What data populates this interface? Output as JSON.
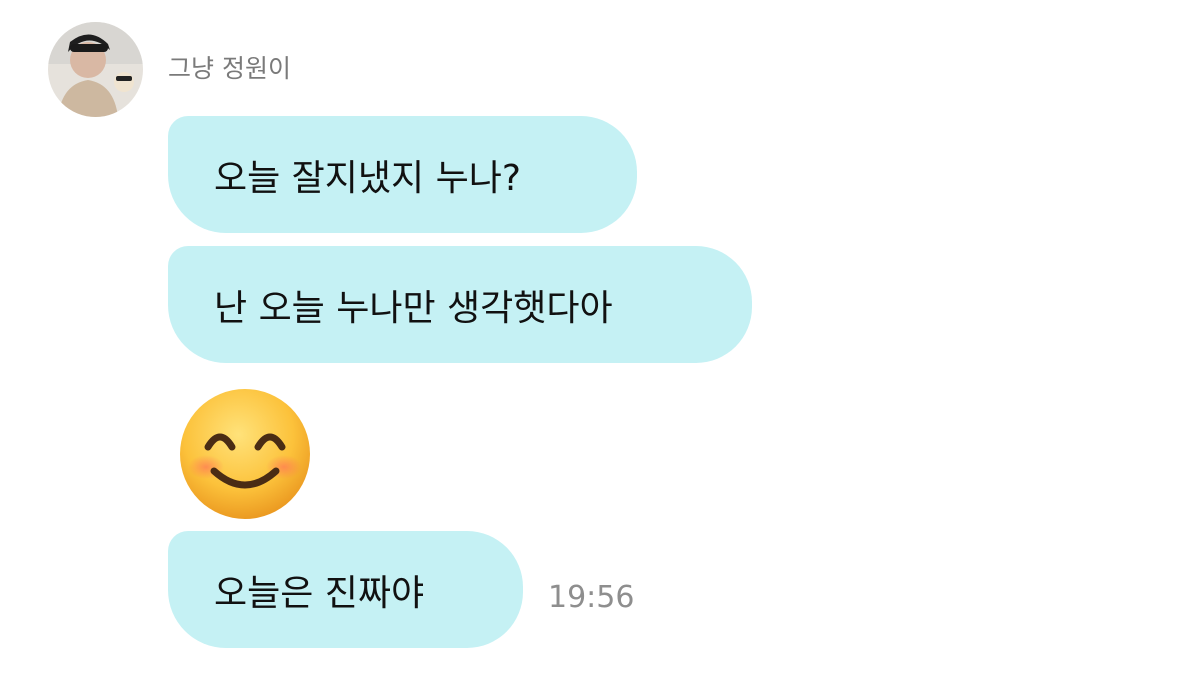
{
  "sender": {
    "name": "그냥 정원이",
    "avatar_icon": "profile-photo-avatar-icon"
  },
  "messages": [
    {
      "text": "오늘 잘지냈지 누나?"
    },
    {
      "text": "난 오늘 누나만 생각햇다아"
    },
    {
      "emoji": "smiling-face-with-smiling-eyes-icon"
    },
    {
      "text": "오늘은 진짜야"
    }
  ],
  "last_message_time": "19:56",
  "colors": {
    "bubble": "#c5f1f4",
    "sender_name": "#7a7a7a",
    "timestamp": "#8e8e8e",
    "message_text": "#111111",
    "background": "#ffffff"
  }
}
